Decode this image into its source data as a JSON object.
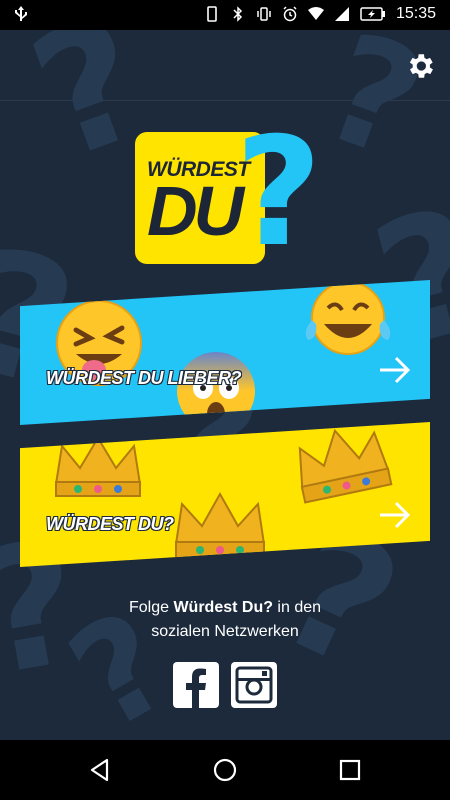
{
  "status_bar": {
    "time": "15:35"
  },
  "banners": [
    {
      "label": "WÜRDEST DU LIEBER?"
    },
    {
      "label": "WÜRDEST DU?"
    }
  ],
  "logo": {
    "word1": "WÜRDEST",
    "word2": "DU",
    "mark": "?"
  },
  "follow": {
    "prefix": "Folge ",
    "brand": "Würdest Du?",
    "suffix": " in den",
    "line2": "sozialen Netzwerken"
  },
  "colors": {
    "background": "#1c2a3c",
    "blue": "#23c4f6",
    "yellow": "#ffe400"
  },
  "icons": [
    "usb-icon",
    "phone-icon",
    "bluetooth-icon",
    "vibrate-icon",
    "alarm-icon",
    "wifi-icon",
    "signal-icon",
    "battery-icon",
    "settings-icon",
    "arrow-right-icon",
    "facebook-icon",
    "instagram-icon",
    "back-icon",
    "home-icon",
    "recents-icon"
  ]
}
